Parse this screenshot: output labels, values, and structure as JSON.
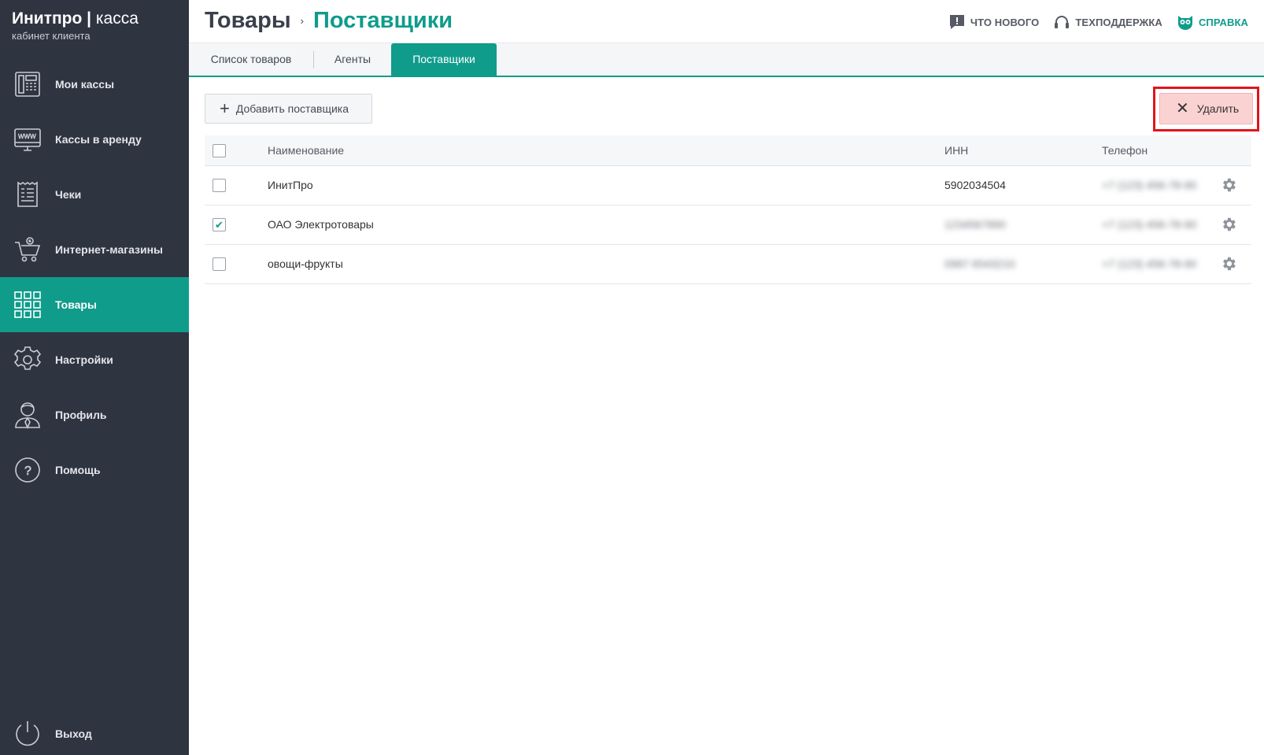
{
  "brand": {
    "name": "Инитпро",
    "product": "касса",
    "subtitle": "кабинет клиента"
  },
  "sidebar": {
    "items": [
      {
        "label": "Мои кассы",
        "icon": "cash-register-icon",
        "active": false
      },
      {
        "label": "Кассы в аренду",
        "icon": "www-monitor-icon",
        "active": false
      },
      {
        "label": "Чеки",
        "icon": "receipt-icon",
        "active": false
      },
      {
        "label": "Интернет-магазины",
        "icon": "cart-icon",
        "active": false
      },
      {
        "label": "Товары",
        "icon": "grid-icon",
        "active": true
      },
      {
        "label": "Настройки",
        "icon": "gear-icon",
        "active": false
      },
      {
        "label": "Профиль",
        "icon": "user-icon",
        "active": false
      },
      {
        "label": "Помощь",
        "icon": "question-icon",
        "active": false
      }
    ],
    "logout": {
      "label": "Выход",
      "icon": "power-icon"
    }
  },
  "header": {
    "breadcrumb": [
      "Товары",
      "Поставщики"
    ],
    "separator": "›",
    "links": [
      {
        "label": "Что нового",
        "icon": "chat-alert-icon"
      },
      {
        "label": "Техподдержка",
        "icon": "headset-icon"
      },
      {
        "label": "Справка",
        "icon": "owl-icon"
      }
    ]
  },
  "tabs": [
    {
      "label": "Список товаров",
      "active": false
    },
    {
      "label": "Агенты",
      "active": false
    },
    {
      "label": "Поставщики",
      "active": true
    }
  ],
  "toolbar": {
    "add_label": "Добавить поставщика",
    "delete_label": "Удалить"
  },
  "table": {
    "columns": [
      "Наименование",
      "ИНН",
      "Телефон"
    ],
    "rows": [
      {
        "name": "ИнитПро",
        "inn": "5902034504",
        "phone": "+7 (123) 456-78-90",
        "checked": false,
        "inn_blurred": false
      },
      {
        "name": "ОАО Электротовары",
        "inn": "1234567890",
        "phone": "+7 (123) 456-78-90",
        "checked": true,
        "inn_blurred": true
      },
      {
        "name": "овощи-фрукты",
        "inn": "0987 6543210",
        "phone": "+7 (123) 456-78-90",
        "checked": false,
        "inn_blurred": true
      }
    ]
  },
  "colors": {
    "accent": "#0f9c8b",
    "sidebar": "#2f3441",
    "danger_bg": "#fbd2d2",
    "highlight": "#e2141b"
  }
}
